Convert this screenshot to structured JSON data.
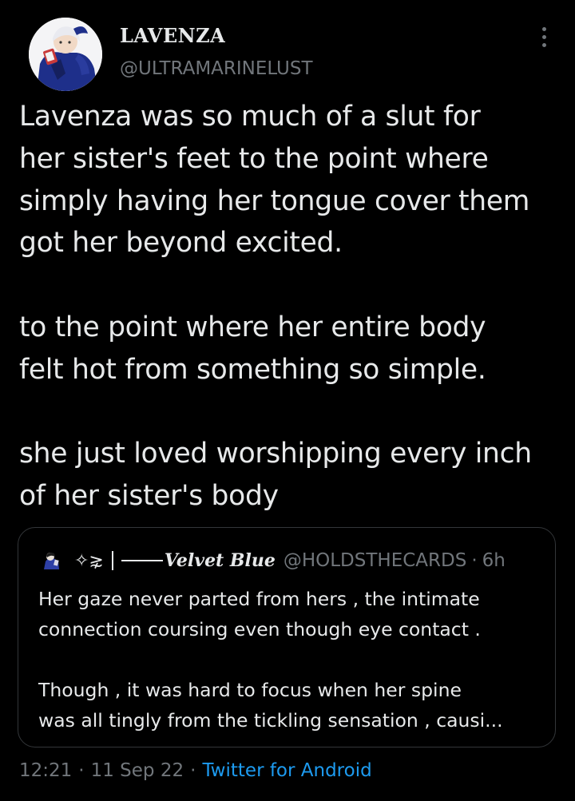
{
  "author": {
    "display_name": "LAVENZA",
    "handle": "@ULTRAMARINELUST",
    "avatar_icon": "profile-avatar"
  },
  "tweet": {
    "paragraphs": [
      "Lavenza was so much of a slut for\nher sister's feet to the point where\nsimply having her tongue cover them\ngot her beyond excited.",
      "to the point where her entire body\nfelt hot from something so simple.",
      "she just loved worshipping every inch\nof her sister's body"
    ]
  },
  "quote": {
    "decoration": "✧⋧",
    "display_name": "Velvet Blue",
    "handle": "@HOLDSTHECARDS",
    "separator": "·",
    "time": "6h",
    "paragraphs": [
      "Her gaze never parted from hers ,  the intimate\nconnection coursing even though eye contact .",
      "Though ,  it was hard to focus when her spine\nwas all tingly from the tickling sensation ,  causi..."
    ]
  },
  "meta": {
    "time": "12:21",
    "date": "11 Sep 22",
    "separator": "·",
    "source": "Twitter for Android"
  },
  "colors": {
    "background": "#000000",
    "text": "#e7e9ea",
    "secondary": "#71767b",
    "link": "#1d9bf0",
    "border": "#333639"
  }
}
